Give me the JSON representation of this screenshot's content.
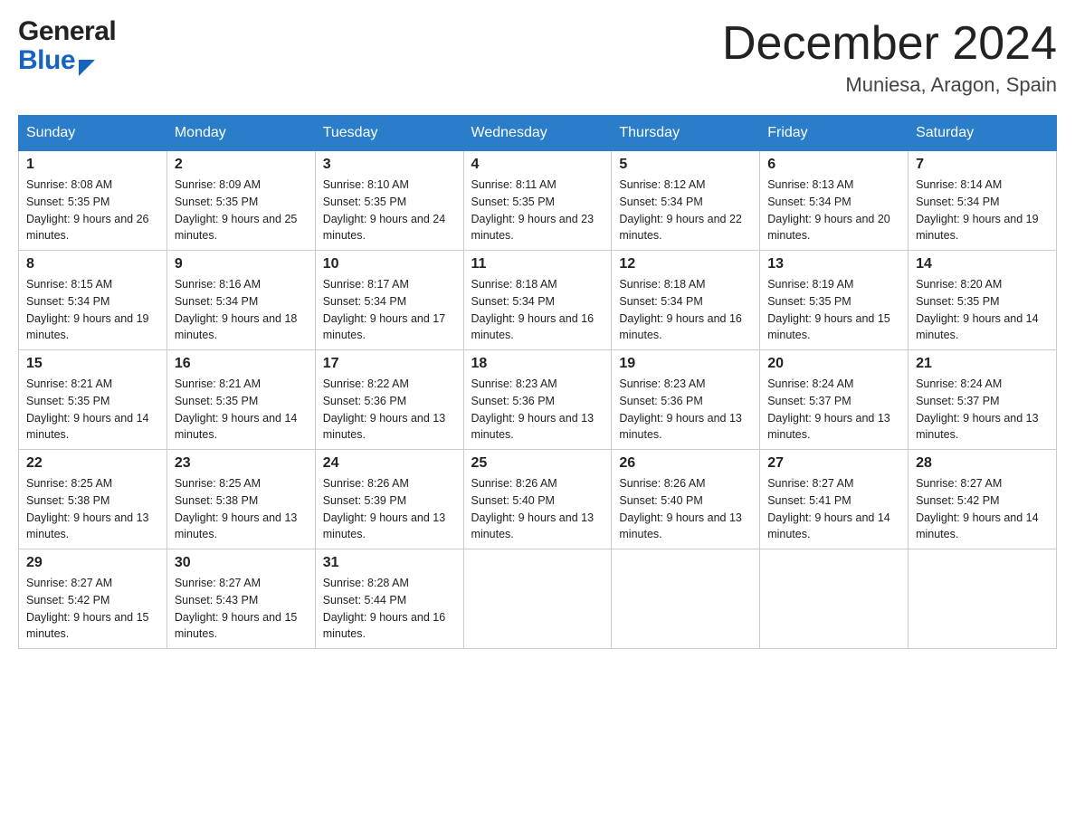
{
  "header": {
    "logo_general": "General",
    "logo_blue": "Blue",
    "month_title": "December 2024",
    "location": "Muniesa, Aragon, Spain"
  },
  "days_of_week": [
    "Sunday",
    "Monday",
    "Tuesday",
    "Wednesday",
    "Thursday",
    "Friday",
    "Saturday"
  ],
  "weeks": [
    [
      {
        "num": "1",
        "sunrise": "8:08 AM",
        "sunset": "5:35 PM",
        "daylight": "9 hours and 26 minutes."
      },
      {
        "num": "2",
        "sunrise": "8:09 AM",
        "sunset": "5:35 PM",
        "daylight": "9 hours and 25 minutes."
      },
      {
        "num": "3",
        "sunrise": "8:10 AM",
        "sunset": "5:35 PM",
        "daylight": "9 hours and 24 minutes."
      },
      {
        "num": "4",
        "sunrise": "8:11 AM",
        "sunset": "5:35 PM",
        "daylight": "9 hours and 23 minutes."
      },
      {
        "num": "5",
        "sunrise": "8:12 AM",
        "sunset": "5:34 PM",
        "daylight": "9 hours and 22 minutes."
      },
      {
        "num": "6",
        "sunrise": "8:13 AM",
        "sunset": "5:34 PM",
        "daylight": "9 hours and 20 minutes."
      },
      {
        "num": "7",
        "sunrise": "8:14 AM",
        "sunset": "5:34 PM",
        "daylight": "9 hours and 19 minutes."
      }
    ],
    [
      {
        "num": "8",
        "sunrise": "8:15 AM",
        "sunset": "5:34 PM",
        "daylight": "9 hours and 19 minutes."
      },
      {
        "num": "9",
        "sunrise": "8:16 AM",
        "sunset": "5:34 PM",
        "daylight": "9 hours and 18 minutes."
      },
      {
        "num": "10",
        "sunrise": "8:17 AM",
        "sunset": "5:34 PM",
        "daylight": "9 hours and 17 minutes."
      },
      {
        "num": "11",
        "sunrise": "8:18 AM",
        "sunset": "5:34 PM",
        "daylight": "9 hours and 16 minutes."
      },
      {
        "num": "12",
        "sunrise": "8:18 AM",
        "sunset": "5:34 PM",
        "daylight": "9 hours and 16 minutes."
      },
      {
        "num": "13",
        "sunrise": "8:19 AM",
        "sunset": "5:35 PM",
        "daylight": "9 hours and 15 minutes."
      },
      {
        "num": "14",
        "sunrise": "8:20 AM",
        "sunset": "5:35 PM",
        "daylight": "9 hours and 14 minutes."
      }
    ],
    [
      {
        "num": "15",
        "sunrise": "8:21 AM",
        "sunset": "5:35 PM",
        "daylight": "9 hours and 14 minutes."
      },
      {
        "num": "16",
        "sunrise": "8:21 AM",
        "sunset": "5:35 PM",
        "daylight": "9 hours and 14 minutes."
      },
      {
        "num": "17",
        "sunrise": "8:22 AM",
        "sunset": "5:36 PM",
        "daylight": "9 hours and 13 minutes."
      },
      {
        "num": "18",
        "sunrise": "8:23 AM",
        "sunset": "5:36 PM",
        "daylight": "9 hours and 13 minutes."
      },
      {
        "num": "19",
        "sunrise": "8:23 AM",
        "sunset": "5:36 PM",
        "daylight": "9 hours and 13 minutes."
      },
      {
        "num": "20",
        "sunrise": "8:24 AM",
        "sunset": "5:37 PM",
        "daylight": "9 hours and 13 minutes."
      },
      {
        "num": "21",
        "sunrise": "8:24 AM",
        "sunset": "5:37 PM",
        "daylight": "9 hours and 13 minutes."
      }
    ],
    [
      {
        "num": "22",
        "sunrise": "8:25 AM",
        "sunset": "5:38 PM",
        "daylight": "9 hours and 13 minutes."
      },
      {
        "num": "23",
        "sunrise": "8:25 AM",
        "sunset": "5:38 PM",
        "daylight": "9 hours and 13 minutes."
      },
      {
        "num": "24",
        "sunrise": "8:26 AM",
        "sunset": "5:39 PM",
        "daylight": "9 hours and 13 minutes."
      },
      {
        "num": "25",
        "sunrise": "8:26 AM",
        "sunset": "5:40 PM",
        "daylight": "9 hours and 13 minutes."
      },
      {
        "num": "26",
        "sunrise": "8:26 AM",
        "sunset": "5:40 PM",
        "daylight": "9 hours and 13 minutes."
      },
      {
        "num": "27",
        "sunrise": "8:27 AM",
        "sunset": "5:41 PM",
        "daylight": "9 hours and 14 minutes."
      },
      {
        "num": "28",
        "sunrise": "8:27 AM",
        "sunset": "5:42 PM",
        "daylight": "9 hours and 14 minutes."
      }
    ],
    [
      {
        "num": "29",
        "sunrise": "8:27 AM",
        "sunset": "5:42 PM",
        "daylight": "9 hours and 15 minutes."
      },
      {
        "num": "30",
        "sunrise": "8:27 AM",
        "sunset": "5:43 PM",
        "daylight": "9 hours and 15 minutes."
      },
      {
        "num": "31",
        "sunrise": "8:28 AM",
        "sunset": "5:44 PM",
        "daylight": "9 hours and 16 minutes."
      },
      null,
      null,
      null,
      null
    ]
  ]
}
